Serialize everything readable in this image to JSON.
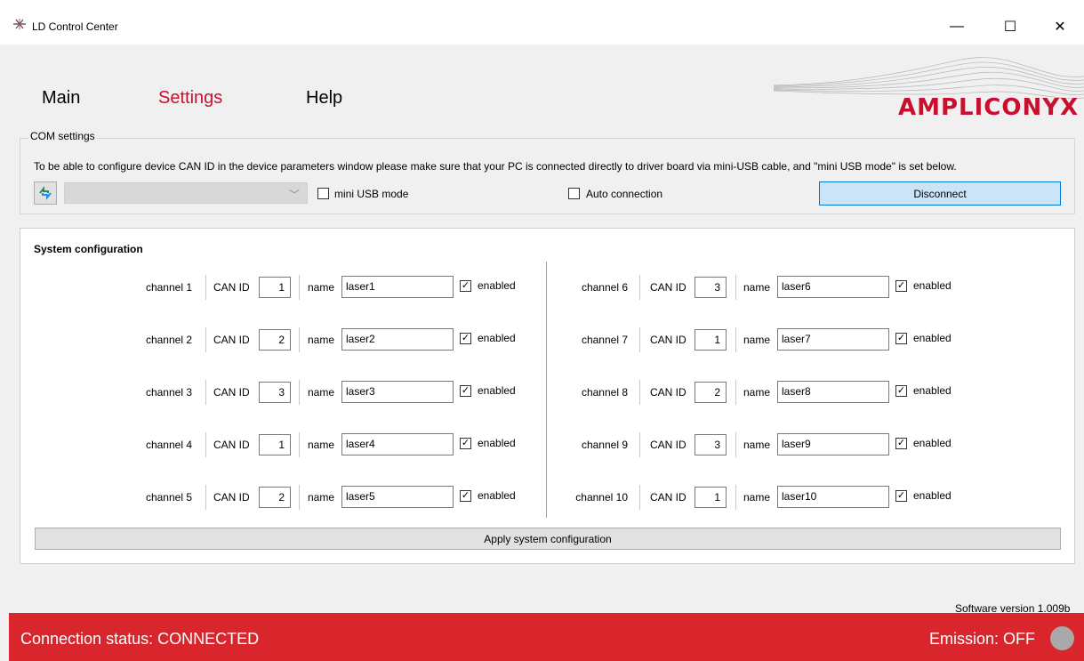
{
  "window": {
    "title": "LD Control Center",
    "minimize": "—",
    "maximize": "☐",
    "close": "✕"
  },
  "menu": {
    "main": "Main",
    "settings": "Settings",
    "help": "Help"
  },
  "logo": {
    "text": "AMPLICONYX"
  },
  "com_settings": {
    "legend": "COM settings",
    "info": "To be able to configure device CAN ID in the device parameters window please make sure that your PC is connected directly to driver board via mini-USB cable, and \"mini USB mode\" is set below.",
    "port_value": "",
    "mini_usb_label": "mini USB mode",
    "mini_usb_checked": false,
    "auto_connection_label": "Auto connection",
    "auto_connection_checked": false,
    "disconnect_label": "Disconnect"
  },
  "system_config": {
    "title": "System configuration",
    "can_id_label": "CAN ID",
    "name_label": "name",
    "enabled_label": "enabled",
    "check_mark": "✓",
    "channels": [
      {
        "label": "channel 1",
        "can_id": "1",
        "name": "laser1",
        "enabled": true
      },
      {
        "label": "channel 2",
        "can_id": "2",
        "name": "laser2",
        "enabled": true
      },
      {
        "label": "channel 3",
        "can_id": "3",
        "name": "laser3",
        "enabled": true
      },
      {
        "label": "channel 4",
        "can_id": "1",
        "name": "laser4",
        "enabled": true
      },
      {
        "label": "channel 5",
        "can_id": "2",
        "name": "laser5",
        "enabled": true
      },
      {
        "label": "channel 6",
        "can_id": "3",
        "name": "laser6",
        "enabled": true
      },
      {
        "label": "channel 7",
        "can_id": "1",
        "name": "laser7",
        "enabled": true
      },
      {
        "label": "channel 8",
        "can_id": "2",
        "name": "laser8",
        "enabled": true
      },
      {
        "label": "channel 9",
        "can_id": "3",
        "name": "laser9",
        "enabled": true
      },
      {
        "label": "channel 10",
        "can_id": "1",
        "name": "laser10",
        "enabled": true
      }
    ],
    "apply_label": "Apply system configuration"
  },
  "software_version": "Software version 1.009b",
  "status": {
    "connection": "Connection status: CONNECTED",
    "emission": "Emission: OFF",
    "bar_color": "#d9262d",
    "led_color": "#a9a9a9"
  }
}
